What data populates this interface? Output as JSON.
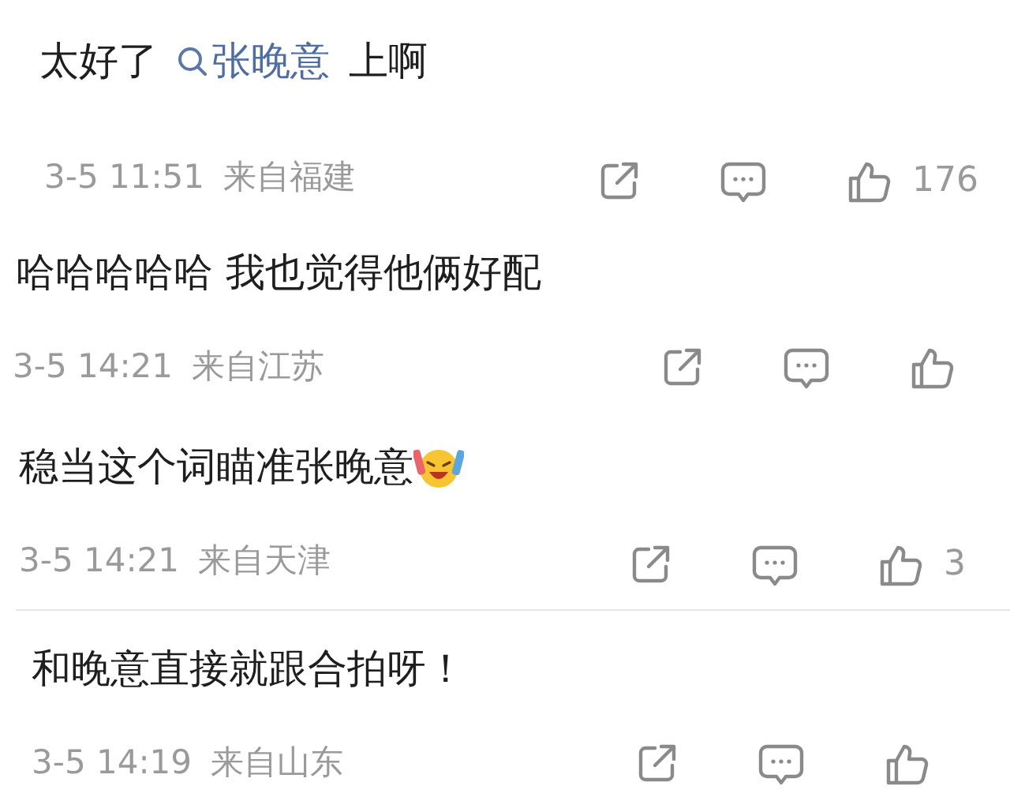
{
  "comments": [
    {
      "segments": [
        {
          "kind": "text",
          "text": "太好了"
        },
        {
          "kind": "mention",
          "text": "张晚意"
        },
        {
          "kind": "text",
          "text": "上啊"
        }
      ],
      "time": "3-5 11:51",
      "location": "来自福建",
      "likes": "176"
    },
    {
      "segments": [
        {
          "kind": "text",
          "text": "哈哈哈哈哈 我也觉得他俩好配"
        }
      ],
      "time": "3-5 14:21",
      "location": "来自江苏"
    },
    {
      "segments": [
        {
          "kind": "text",
          "text": "稳当这个词瞄准张晚意"
        },
        {
          "kind": "emoji"
        }
      ],
      "time": "3-5 14:21",
      "location": "来自天津",
      "likes": "3"
    },
    {
      "segments": [
        {
          "kind": "text",
          "text": "和晚意直接就跟合拍呀！"
        }
      ],
      "time": "3-5 14:19",
      "location": "来自山东"
    }
  ]
}
